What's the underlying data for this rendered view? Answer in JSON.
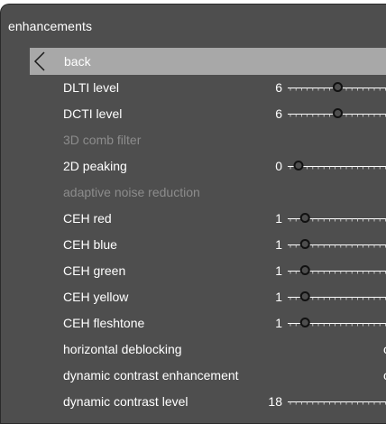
{
  "menu": {
    "title": "enhancements",
    "back_label": "back",
    "slider_max": 20,
    "items": [
      {
        "label": "DLTI level",
        "value": "6",
        "level": 6,
        "type": "slider",
        "enabled": true
      },
      {
        "label": "DCTI level",
        "value": "6",
        "level": 6,
        "type": "slider",
        "enabled": true
      },
      {
        "label": "3D comb filter",
        "value": "",
        "type": "none",
        "enabled": false
      },
      {
        "label": "2D peaking",
        "value": "0",
        "level": 0,
        "type": "slider",
        "enabled": true
      },
      {
        "label": "adaptive noise reduction",
        "value": "",
        "type": "none",
        "enabled": false
      },
      {
        "label": "CEH red",
        "value": "1",
        "level": 1,
        "type": "slider",
        "enabled": true
      },
      {
        "label": "CEH blue",
        "value": "1",
        "level": 1,
        "type": "slider",
        "enabled": true
      },
      {
        "label": "CEH green",
        "value": "1",
        "level": 1,
        "type": "slider",
        "enabled": true
      },
      {
        "label": "CEH yellow",
        "value": "1",
        "level": 1,
        "type": "slider",
        "enabled": true
      },
      {
        "label": "CEH fleshtone",
        "value": "1",
        "level": 1,
        "type": "slider",
        "enabled": true
      },
      {
        "label": "horizontal deblocking",
        "value": "",
        "suffix": "o",
        "type": "toggle",
        "enabled": true
      },
      {
        "label": "dynamic contrast enhancement",
        "value": "",
        "suffix": "o",
        "type": "toggle",
        "enabled": true
      },
      {
        "label": "dynamic contrast level",
        "value": "18",
        "level": 18,
        "type": "slider",
        "enabled": true
      }
    ]
  },
  "colors": {
    "panel_bg": "#4e4e4e",
    "highlight": "#a8a8a8",
    "text": "#ffffff",
    "disabled_text": "#8c8c8c"
  }
}
